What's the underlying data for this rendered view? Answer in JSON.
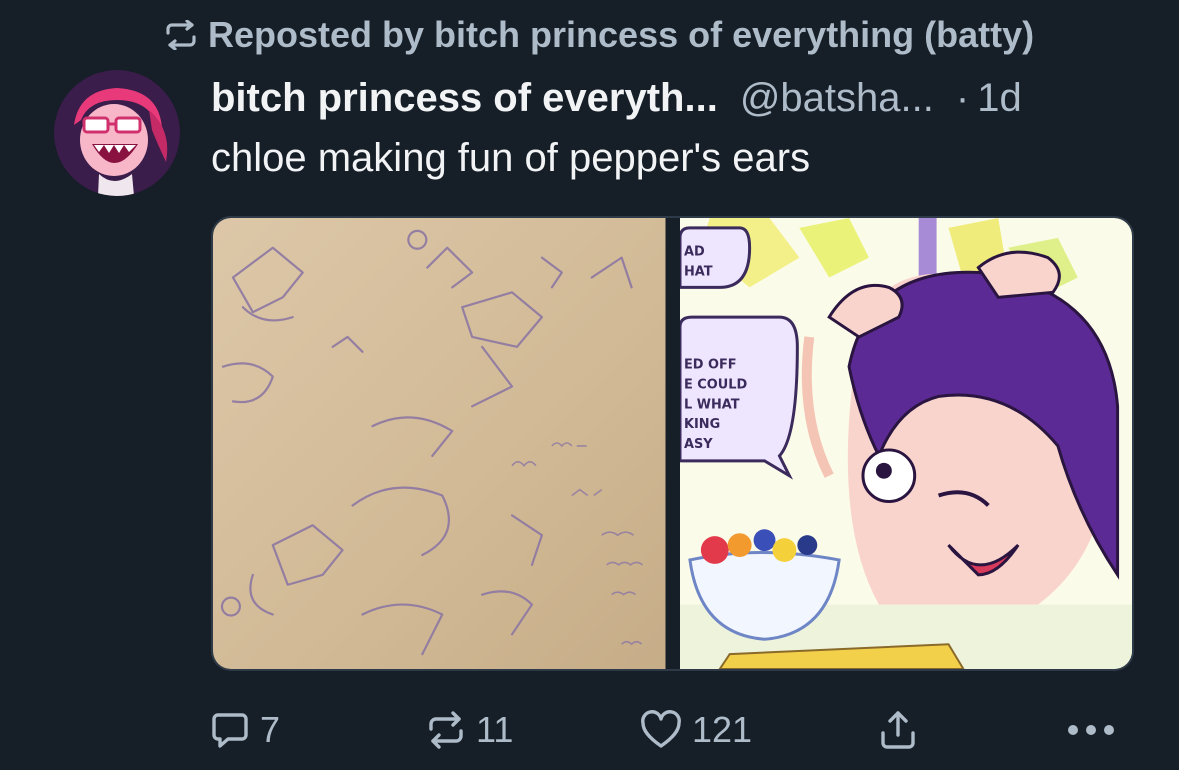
{
  "repost": {
    "label": "Reposted by bitch princess of everything (batty)",
    "icon": "repost-icon"
  },
  "post": {
    "display_name": "bitch princess of everyth...",
    "handle": "@batsha...",
    "separator": "·",
    "timestamp": "1d",
    "text": "chloe making fun of pepper's ears",
    "avatar": "avatar-image",
    "images": [
      {
        "name": "sketch-image"
      },
      {
        "name": "comic-image"
      }
    ]
  },
  "actions": {
    "reply_count": "7",
    "repost_count": "11",
    "like_count": "121"
  },
  "colors": {
    "background": "#161e27",
    "text": "#f1f3f5",
    "muted": "#aebbc9"
  }
}
